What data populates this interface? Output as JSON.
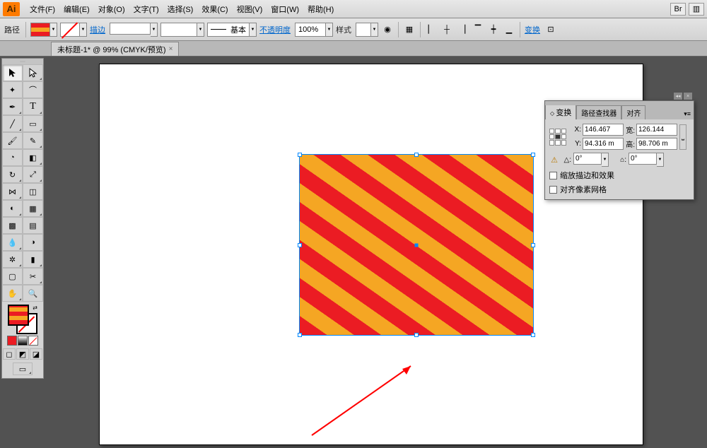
{
  "menu": {
    "file": "文件(F)",
    "edit": "编辑(E)",
    "object": "对象(O)",
    "text": "文字(T)",
    "select": "选择(S)",
    "effect": "效果(C)",
    "view": "视图(V)",
    "window": "窗口(W)",
    "help": "帮助(H)"
  },
  "logo": "Ai",
  "control": {
    "path_label": "路径",
    "stroke_label": "描边",
    "basic_label": "基本",
    "opacity_label": "不透明度",
    "opacity_value": "100%",
    "style_label": "样式",
    "transform_link": "变换"
  },
  "document_tab": "未标题-1* @ 99% (CMYK/预览)",
  "transform_panel": {
    "tab_transform": "变换",
    "tab_pathfinder": "路径查找器",
    "tab_align": "对齐",
    "x_label": "X:",
    "x_value": "146.467",
    "y_label": "Y:",
    "y_value": "94.316 m",
    "w_label": "宽:",
    "w_value": "126.144",
    "h_label": "高:",
    "h_value": "98.706 m",
    "angle_label": "△:",
    "angle_value": "0°",
    "shear_label": "⌂:",
    "shear_value": "0°",
    "scale_strokes": "缩放描边和效果",
    "align_pixel": "对齐像素网格"
  }
}
